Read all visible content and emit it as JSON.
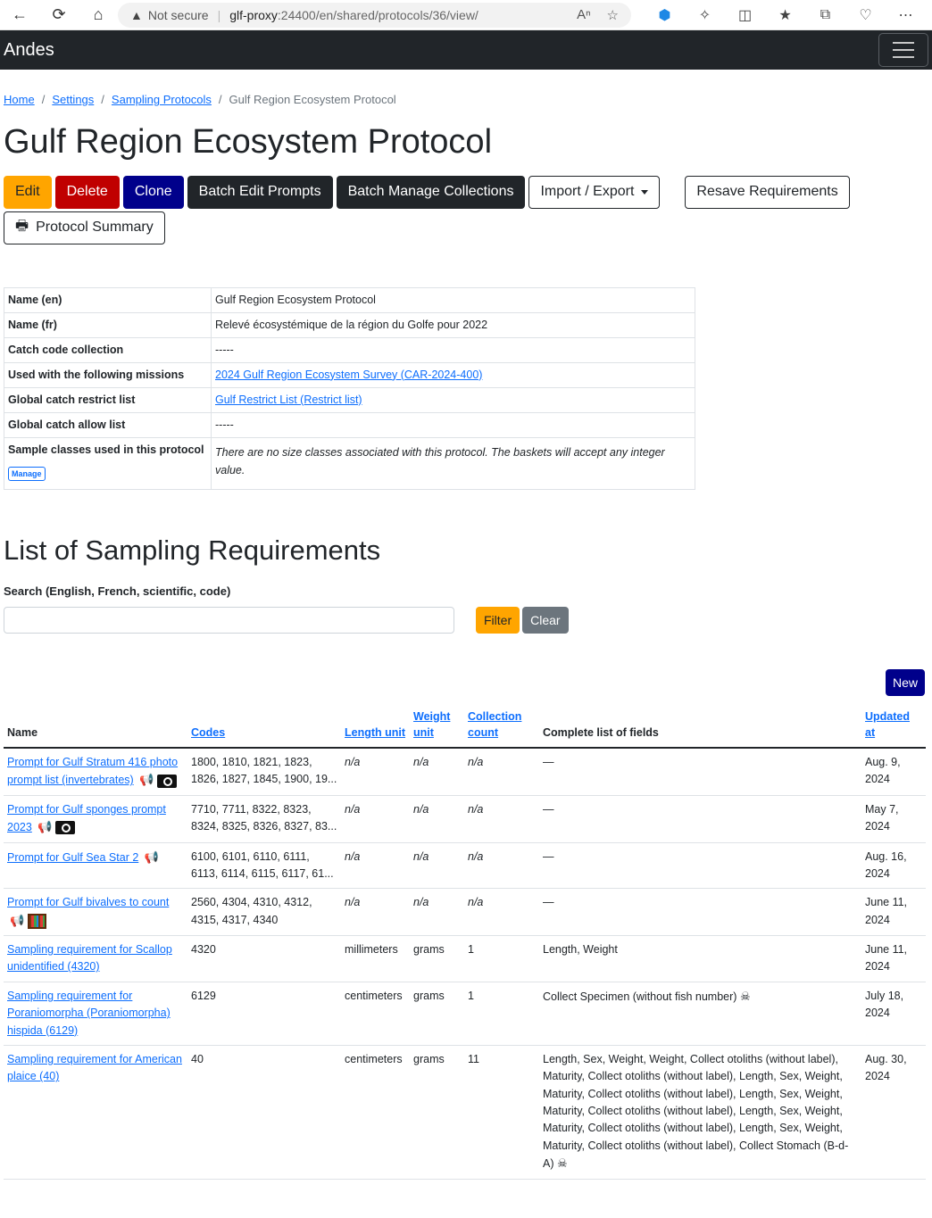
{
  "browser": {
    "security": "Not secure",
    "url_host": "glf-proxy",
    "url_rest": ":24400/en/shared/protocols/36/view/"
  },
  "navbar": {
    "brand": "Andes"
  },
  "breadcrumb": [
    "Home",
    "Settings",
    "Sampling Protocols",
    "Gulf Region Ecosystem Protocol"
  ],
  "page_title": "Gulf Region Ecosystem Protocol",
  "buttons": {
    "edit": "Edit",
    "delete": "Delete",
    "clone": "Clone",
    "batch_edit": "Batch Edit Prompts",
    "batch_manage": "Batch Manage Collections",
    "import_export": "Import / Export",
    "resave": "Resave Requirements",
    "summary": "Protocol Summary"
  },
  "details": [
    {
      "label": "Name (en)",
      "value": "Gulf Region Ecosystem Protocol"
    },
    {
      "label": "Name (fr)",
      "value": "Relevé écosystémique de la région du Golfe pour 2022"
    },
    {
      "label": "Catch code collection",
      "value": "-----"
    },
    {
      "label": "Used with the following missions",
      "value": "2024 Gulf Region Ecosystem Survey (CAR-2024-400)"
    },
    {
      "label": "Global catch restrict list",
      "value": "Gulf Restrict List (Restrict list)"
    },
    {
      "label": "Global catch allow list",
      "value": "-----"
    },
    {
      "label": "Sample classes used in this protocol",
      "value": "There are no size classes associated with this protocol. The baskets will accept any integer value.",
      "action": "Manage"
    }
  ],
  "requirements_section": {
    "title": "List of Sampling Requirements",
    "search_label": "Search (English, French, scientific, code)",
    "search_value": "",
    "filter": "Filter",
    "clear": "Clear",
    "new": "New"
  },
  "table": {
    "headers": {
      "name": "Name",
      "codes": "Codes",
      "length_unit": "Length unit",
      "weight_unit": "Weight unit",
      "collection_count": "Collection count",
      "fields": "Complete list of fields",
      "updated": "Updated at"
    },
    "rows": [
      {
        "name": "Prompt for Gulf Stratum 416 photo prompt list (invertebrates)",
        "codes": "1800, 1810, 1821, 1823, 1826, 1827, 1845, 1900, 19...",
        "length": "n/a",
        "weight": "n/a",
        "count": "n/a",
        "fields": "—",
        "updated": "Aug. 9, 2024",
        "icons": [
          "megaphone-icon",
          "camera-icon"
        ]
      },
      {
        "name": "Prompt for Gulf sponges prompt 2023",
        "codes": "7710, 7711, 8322, 8323, 8324, 8325, 8326, 8327, 83...",
        "length": "n/a",
        "weight": "n/a",
        "count": "n/a",
        "fields": "—",
        "updated": "May 7, 2024",
        "icons": [
          "megaphone-icon",
          "camera-icon"
        ]
      },
      {
        "name": "Prompt for Gulf Sea Star 2",
        "codes": "6100, 6101, 6110, 6111, 6113, 6114, 6115, 6117, 61...",
        "length": "n/a",
        "weight": "n/a",
        "count": "n/a",
        "fields": "—",
        "updated": "Aug. 16, 2024",
        "icons": [
          "megaphone-icon"
        ]
      },
      {
        "name": "Prompt for Gulf bivalves to count",
        "codes": "2560, 4304, 4310, 4312, 4315, 4317, 4340",
        "length": "n/a",
        "weight": "n/a",
        "count": "n/a",
        "fields": "—",
        "updated": "June 11, 2024",
        "icons": [
          "megaphone-icon",
          "abacus-icon"
        ]
      },
      {
        "name": "Sampling requirement for Scallop unidentified (4320)",
        "codes": "4320",
        "length": "millimeters",
        "weight": "grams",
        "count": "1",
        "fields": "Length, Weight",
        "updated": "June 11, 2024",
        "icons": []
      },
      {
        "name": "Sampling requirement for Poraniomorpha (Poraniomorpha) hispida (6129)",
        "codes": "6129",
        "length": "centimeters",
        "weight": "grams",
        "count": "1",
        "fields": "Collect Specimen (without fish number)",
        "updated": "July 18, 2024",
        "icons": [],
        "fields_icon": "skull-icon"
      },
      {
        "name": "Sampling requirement for American plaice (40)",
        "codes": "40",
        "length": "centimeters",
        "weight": "grams",
        "count": "11",
        "fields": "Length, Sex, Weight, Weight, Collect otoliths (without label), Maturity, Collect otoliths (without label), Length, Sex, Weight, Maturity, Collect otoliths (without label), Length, Sex, Weight, Maturity, Collect otoliths (without label), Length, Sex, Weight, Maturity, Collect otoliths (without label), Length, Sex, Weight, Maturity, Collect otoliths (without label), Collect Stomach (B-d-A)",
        "updated": "Aug. 30, 2024",
        "icons": [],
        "fields_icon": "skull-icon"
      }
    ]
  }
}
